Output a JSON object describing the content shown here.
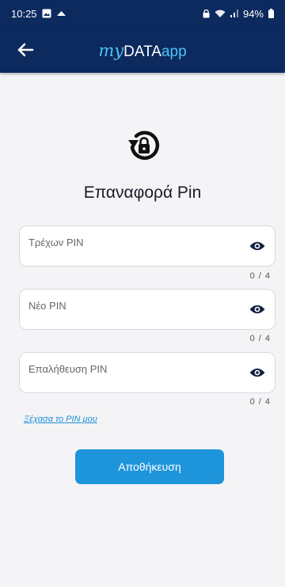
{
  "status_bar": {
    "time": "10:25",
    "battery": "94%"
  },
  "header": {
    "brand_my": "my",
    "brand_data": "DATA",
    "brand_app": "app"
  },
  "page": {
    "title": "Επαναφορά Pin"
  },
  "fields": [
    {
      "label": "Τρέχων PIN",
      "counter": "0 / 4"
    },
    {
      "label": "Νέο PIN",
      "counter": "0 / 4"
    },
    {
      "label": "Επαλήθευση PIN",
      "counter": "0 / 4"
    }
  ],
  "links": {
    "forgot_pin": "Ξέχασα το PIN μου"
  },
  "actions": {
    "save_label": "Αποθήκευση"
  },
  "colors": {
    "header_bg": "#0c2a5e",
    "accent": "#1e95db",
    "brand_light": "#4fc3f7"
  }
}
